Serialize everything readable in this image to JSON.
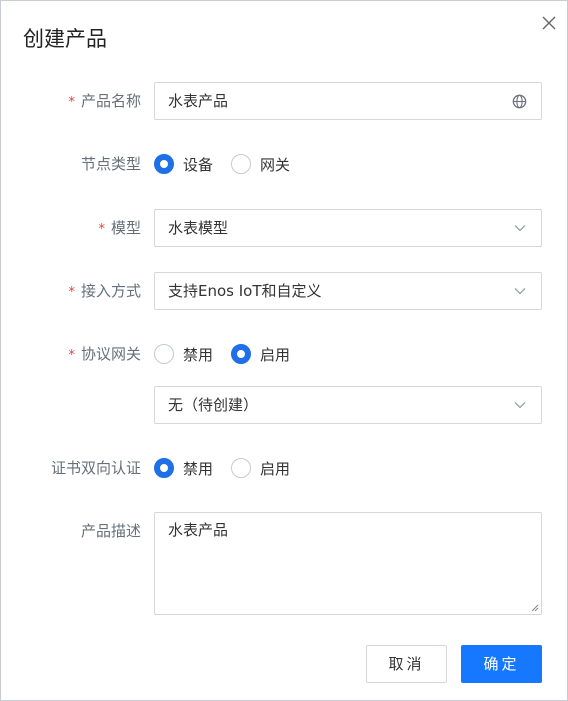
{
  "dialog": {
    "title": "创建产品",
    "close_icon": "close-icon"
  },
  "form": {
    "product_name": {
      "required": true,
      "label": "产品名称",
      "value": "水表产品",
      "icon": "globe-icon"
    },
    "node_type": {
      "label": "节点类型",
      "options": [
        "设备",
        "网关"
      ],
      "selected": "设备"
    },
    "model": {
      "required": true,
      "label": "模型",
      "value": "水表模型"
    },
    "access_method": {
      "required": true,
      "label": "接入方式",
      "value": "支持Enos IoT和自定义"
    },
    "protocol_gateway": {
      "required": true,
      "label": "协议网关",
      "options": [
        "禁用",
        "启用"
      ],
      "selected": "启用",
      "select_value": "无（待创建）"
    },
    "mutual_cert_auth": {
      "label": "证书双向认证",
      "options": [
        "禁用",
        "启用"
      ],
      "selected": "禁用"
    },
    "description": {
      "label": "产品描述",
      "value": "水表产品"
    },
    "required_mark": "*"
  },
  "footer": {
    "cancel_label": "取消",
    "ok_label": "确定"
  },
  "colors": {
    "primary": "#1677ff",
    "required": "#e0413e",
    "label": "#66707a",
    "border": "#d4d7dc"
  }
}
